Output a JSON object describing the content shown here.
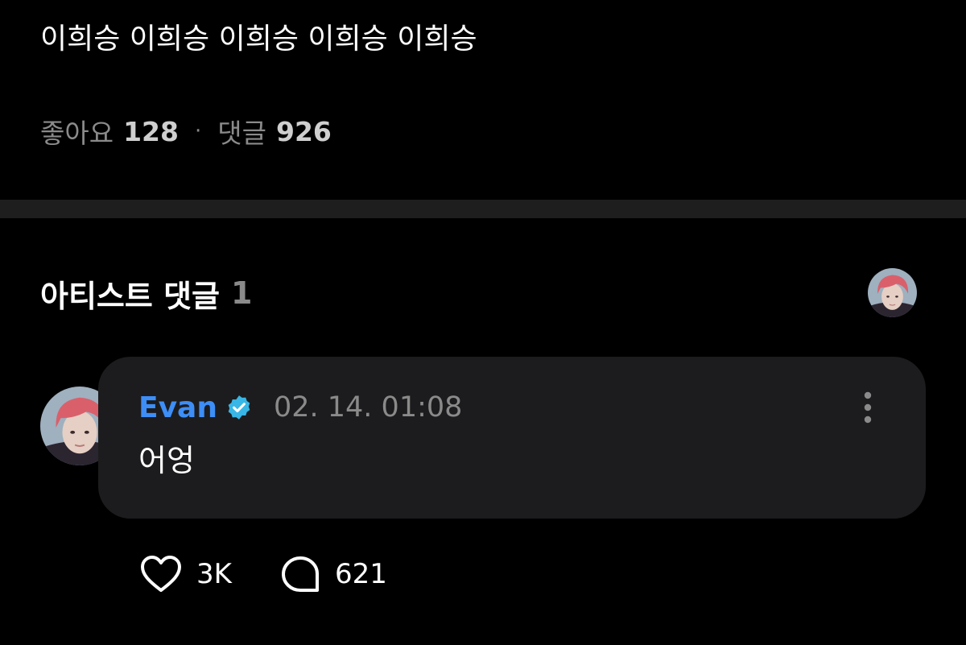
{
  "post": {
    "text": "이희승 이희승 이희승 이희승 이희승",
    "likes_label": "좋아요",
    "likes_count": "128",
    "separator": "·",
    "comments_label": "댓글",
    "comments_count": "926"
  },
  "artist_comments": {
    "title": "아티스트 댓글",
    "count": "1"
  },
  "comment": {
    "author": "Evan",
    "verified": true,
    "timestamp": "02. 14. 01:08",
    "text": "어엉",
    "likes": "3K",
    "replies": "621"
  },
  "colors": {
    "background": "#000000",
    "author_blue": "#3d8ef7",
    "verified_badge": "#38b6e6",
    "bubble": "#1c1c1e",
    "divider": "#1e1e1e",
    "muted_text": "#8a8a8a"
  },
  "icons": {
    "verified": "verified-badge-icon",
    "more": "more-vertical-icon",
    "like": "heart-icon",
    "reply": "speech-bubble-icon"
  }
}
